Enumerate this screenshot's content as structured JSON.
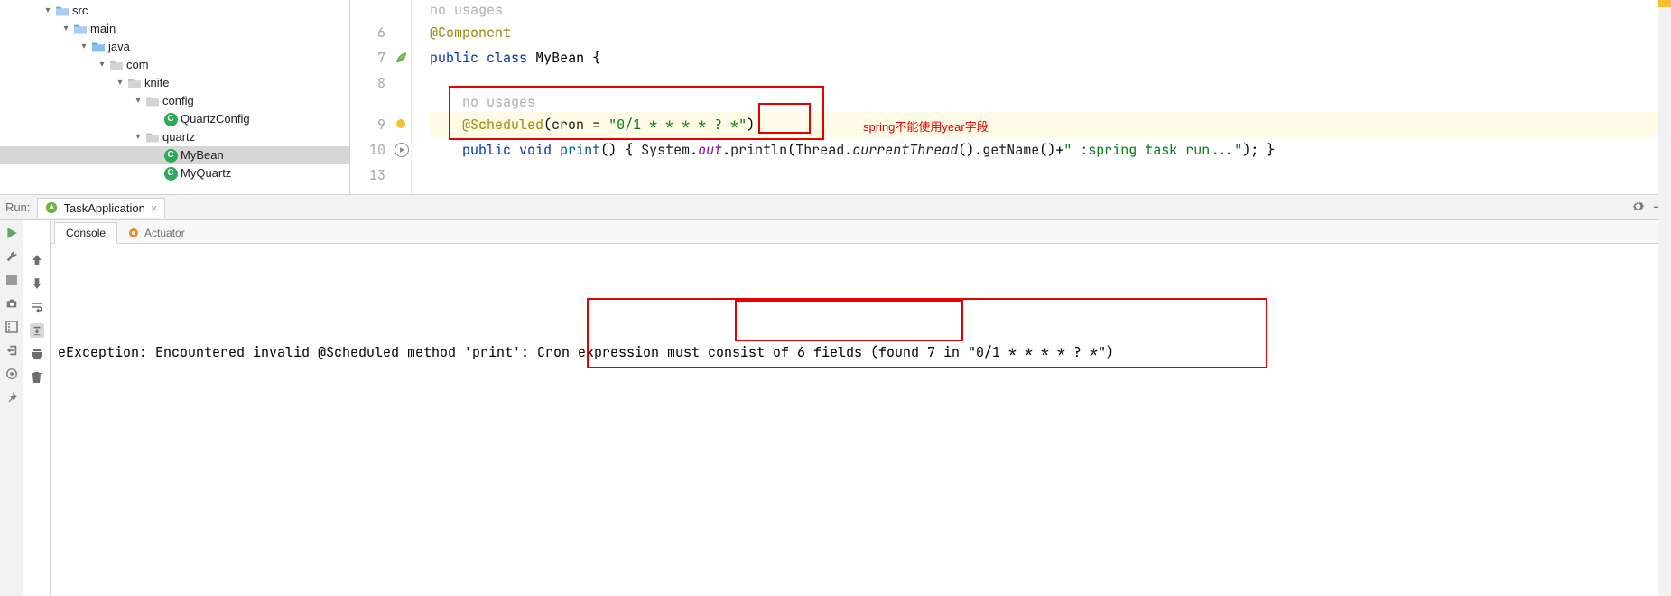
{
  "tree": {
    "src": "src",
    "main": "main",
    "java": "java",
    "com": "com",
    "knife": "knife",
    "config": "config",
    "quartzConfig": "QuartzConfig",
    "quartz": "quartz",
    "myBean": "MyBean",
    "myQuartz": "MyQuartz"
  },
  "editor": {
    "lines": {
      "6": "6",
      "7": "7",
      "8": "8",
      "9": "9",
      "10": "10",
      "13": "13"
    },
    "no_usages_top": "no usages",
    "component": "@Component",
    "public": "public",
    "class_kw": "class",
    "classname": "MyBean",
    "brace_open": "{",
    "no_usages_inner": "no usages",
    "scheduled": "@Scheduled",
    "cron_attr": "cron = ",
    "cron_value": "\"0/1 * * * * ? *\"",
    "void_kw": "void",
    "print_method": "print",
    "system": "System",
    "out": "out",
    "println": "println",
    "thread": "Thread",
    "currentThread": "currentThread",
    "getName": "getName",
    "tail_str": "\" :spring task run...\"",
    "annotation_note": "spring不能使用year字段"
  },
  "run": {
    "label": "Run:",
    "config_name": "TaskApplication",
    "console_tab": "Console",
    "actuator_tab": "Actuator",
    "exception_line": "eException: Encountered invalid @Scheduled method 'print': Cron expression must consist of 6 fields (found 7 in \"0/1 * * * * ? *\")"
  }
}
